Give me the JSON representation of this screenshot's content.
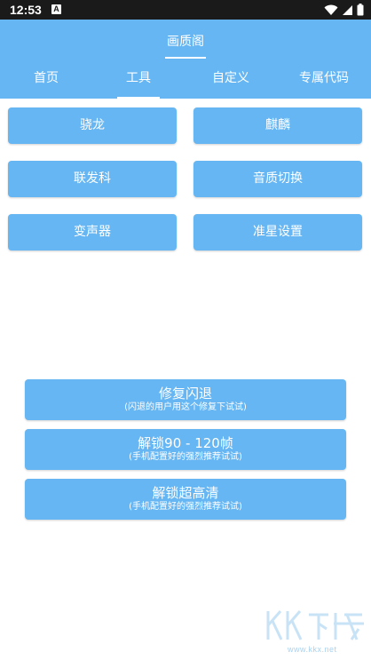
{
  "status": {
    "time": "12:53",
    "notification": "A"
  },
  "app": {
    "title": "画质阁"
  },
  "tabs": [
    {
      "label": "首页"
    },
    {
      "label": "工具",
      "selected": true
    },
    {
      "label": "自定义"
    },
    {
      "label": "专属代码"
    }
  ],
  "tools": [
    {
      "label": "骁龙"
    },
    {
      "label": "麒麟"
    },
    {
      "label": "联发科"
    },
    {
      "label": "音质切换"
    },
    {
      "label": "变声器"
    },
    {
      "label": "准星设置"
    }
  ],
  "actions": [
    {
      "label": "修复闪退",
      "sub": "(闪退的用户用这个修复下试试)"
    },
    {
      "label": "解锁90 - 120帧",
      "sub": "(手机配置好的强烈推荐试试)"
    },
    {
      "label": "解锁超高清",
      "sub": "(手机配置好的强烈推荐试试)"
    }
  ],
  "watermark": {
    "text": "KK下载",
    "url": "www.kkx.net"
  },
  "colors": {
    "accent": "#66b6f3",
    "statusbar": "#1a1a1a",
    "background": "#ffffff"
  }
}
